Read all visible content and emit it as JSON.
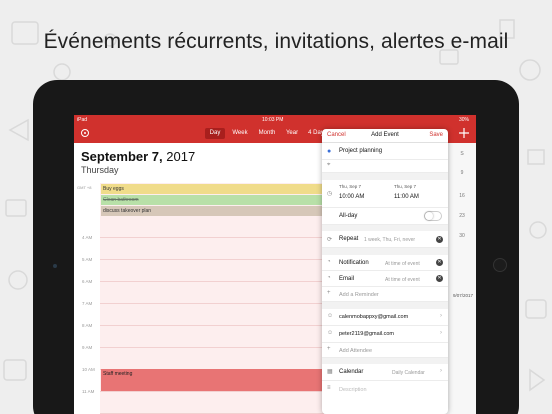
{
  "headline": "Événements récurrents, invitations, alertes e-mail",
  "statusbar": {
    "device": "iPad",
    "time": "10:03 PM",
    "battery": "30%"
  },
  "navbar": {
    "tabs": [
      {
        "label": "Day",
        "active": true
      },
      {
        "label": "Week",
        "active": false
      },
      {
        "label": "Month",
        "active": false
      },
      {
        "label": "Year",
        "active": false
      },
      {
        "label": "4 Day",
        "active": false
      }
    ]
  },
  "day_view": {
    "date_main": "September 7,",
    "date_year": " 2017",
    "weekday": "Thursday",
    "allday_label": "GMT +8",
    "hours": [
      "4 AM",
      "5 AM",
      "6 AM",
      "7 AM",
      "8 AM",
      "9 AM",
      "10 AM",
      "11 AM",
      "12 PM",
      "1 PM",
      "2 PM"
    ],
    "events": [
      {
        "title": "Buy eggs",
        "color": "#f0dc8a",
        "done": false
      },
      {
        "title": "Clean bathroom",
        "color": "#b8e0a8",
        "done": true
      },
      {
        "title": "discuss takeover plan",
        "color": "#d6c7b8",
        "done": false
      }
    ],
    "timed_event": {
      "time": "10 AM",
      "title": "Staff meeting",
      "color": "#e87474"
    }
  },
  "right_strip": {
    "numbers": [
      "S",
      "9",
      "16",
      "23",
      "30"
    ],
    "date_label": "9/07/2017"
  },
  "add_event": {
    "cancel": "Cancel",
    "title": "Add Event",
    "save": "Save",
    "event_name": "Project planning",
    "start_day": "Thu, Sep 7",
    "start_time": "10:00 AM",
    "end_day": "Thu, Sep 7",
    "end_time": "11:00 AM",
    "allday_label": "All-day",
    "allday_on": false,
    "repeat_label": "Repeat",
    "repeat_value": "1 week, Thu, Fri, never",
    "notification_label": "Notification",
    "notification_value": "At time of event",
    "email_label": "Email",
    "email_value": "At time of event",
    "add_reminder": "Add a Reminder",
    "attendees": [
      "calenmobappxy@gmail.com",
      "peter2119@gmail.com"
    ],
    "add_attendee": "Add Attendee",
    "calendar_label": "Calendar",
    "calendar_value": "Daily Calendar",
    "description_placeholder": "Description"
  },
  "colors": {
    "accent": "#d0312d"
  }
}
